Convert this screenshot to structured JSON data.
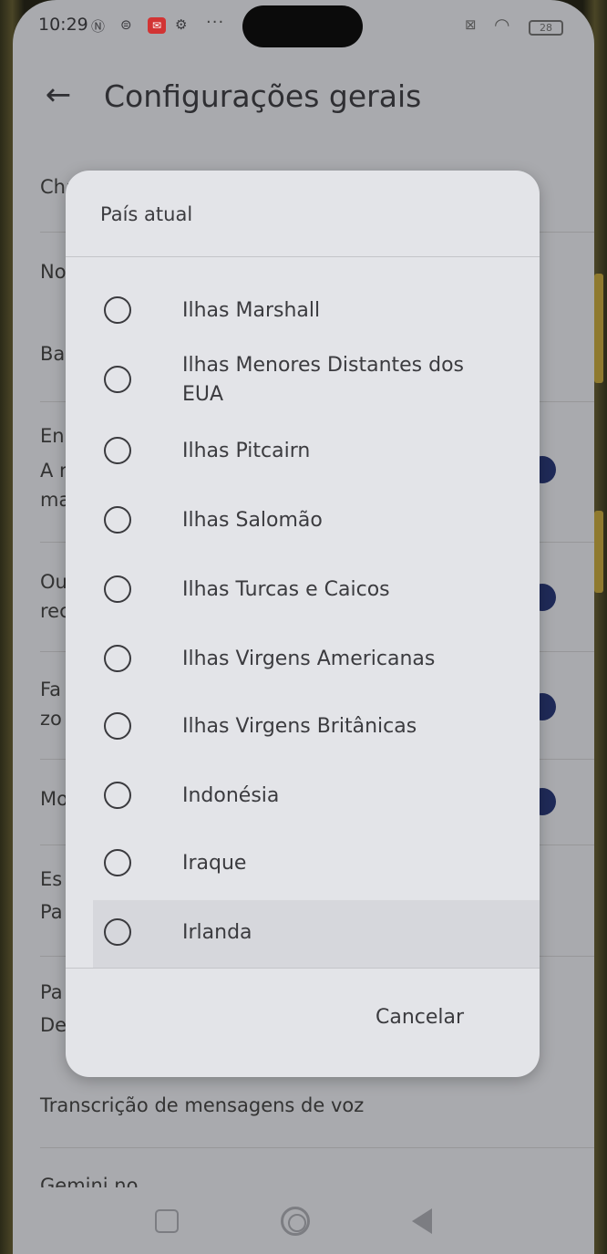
{
  "status_bar": {
    "time": "10:29",
    "battery": "28"
  },
  "header": {
    "back_icon": "arrow-left-icon",
    "title": "Configurações gerais"
  },
  "background_list": {
    "items": [
      "Cha",
      "No",
      "Ba",
      "En",
      "A r",
      "ma",
      "Ou",
      "rec",
      "Fa",
      "zo",
      "Mo",
      "Es",
      "Pa",
      "Pa",
      "De"
    ]
  },
  "dialog": {
    "title": "País atual",
    "options": [
      {
        "label": "Ilhas Marshall"
      },
      {
        "label": "Ilhas Menores Distantes dos",
        "label2": "EUA"
      },
      {
        "label": "Ilhas Pitcairn"
      },
      {
        "label": "Ilhas Salomão"
      },
      {
        "label": "Ilhas Turcas e Caicos"
      },
      {
        "label": "Ilhas Virgens Americanas"
      },
      {
        "label": "Ilhas Virgens Britânicas"
      },
      {
        "label": "Indonésia"
      },
      {
        "label": "Iraque"
      },
      {
        "label": "Irlanda"
      }
    ],
    "cancel_label": "Cancelar"
  },
  "after_dialog": {
    "voice_transcription": "Transcrição de mensagens de voz",
    "gemini": "Gemini no"
  },
  "nav_bar": {
    "recent_icon": "square-icon",
    "home_icon": "circle-icon",
    "back_icon": "triangle-back-icon"
  },
  "colors": {
    "accent": "#1f2a58",
    "dialog_bg": "#e3e4e8",
    "scrim_bg": "#a9aaae"
  }
}
